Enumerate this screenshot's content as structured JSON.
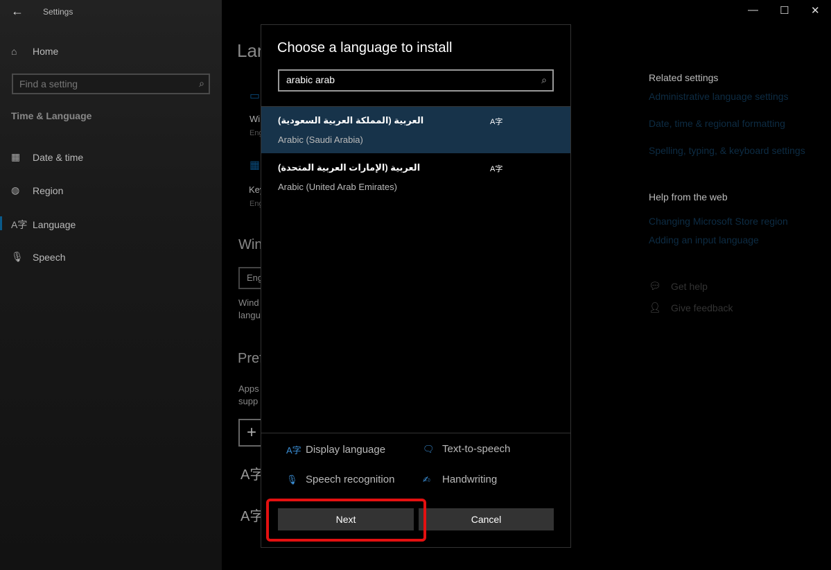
{
  "window": {
    "title": "Settings",
    "controls": [
      "minimize",
      "maximize",
      "close"
    ]
  },
  "sidebar": {
    "home": "Home",
    "search_placeholder": "Find a setting",
    "section": "Time & Language",
    "items": [
      {
        "label": "Date & time",
        "icon": "calendar-clock-icon"
      },
      {
        "label": "Region",
        "icon": "globe-icon"
      },
      {
        "label": "Language",
        "icon": "language-icon",
        "selected": true
      },
      {
        "label": "Speech",
        "icon": "microphone-icon"
      }
    ]
  },
  "main_fragments": {
    "title": "Lan",
    "wi": "Wi",
    "eng1": "Eng",
    "key": "Key",
    "eng2": "Eng",
    "win": "Win",
    "eng3": "Eng",
    "wind": "Wind",
    "langu": "langu",
    "pref": "Pref",
    "apps": "Apps",
    "supp": "supp",
    "plus": "+"
  },
  "related": {
    "heading": "Related settings",
    "links": [
      "Administrative language settings",
      "Date, time & regional formatting",
      "Spelling, typing, & keyboard settings"
    ],
    "help_heading": "Help from the web",
    "help_links": [
      "Changing Microsoft Store region",
      "Adding an input language"
    ],
    "get_help": "Get help",
    "give_feedback": "Give feedback"
  },
  "dialog": {
    "title": "Choose a language to install",
    "search_value": "arabic arab",
    "languages": [
      {
        "native": "العربية (المملكة العربية السعودية)",
        "english": "Arabic (Saudi Arabia)",
        "selected": true
      },
      {
        "native": "العربية (الإمارات العربية المتحدة)",
        "english": "Arabic (United Arab Emirates)",
        "selected": false
      }
    ],
    "features": [
      "Display language",
      "Text-to-speech",
      "Speech recognition",
      "Handwriting"
    ],
    "next": "Next",
    "cancel": "Cancel"
  },
  "colors": {
    "accent": "#3b8fd6",
    "selected_row": "#17334a",
    "highlight": "#e31010"
  }
}
